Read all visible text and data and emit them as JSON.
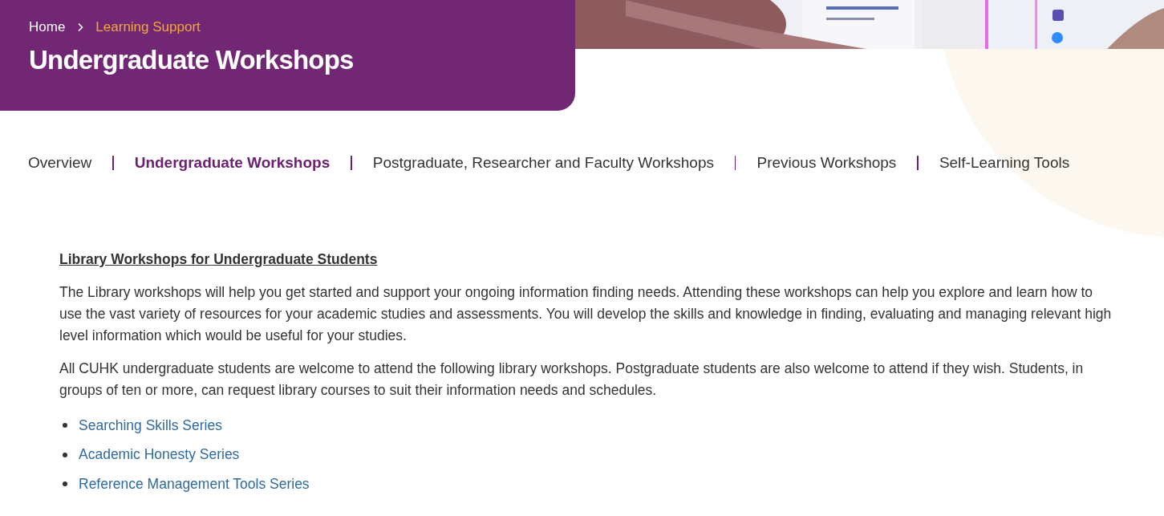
{
  "breadcrumb": [
    {
      "label": "Home",
      "current": false
    },
    {
      "label": "Learning Support",
      "current": true
    }
  ],
  "page_title": "Undergraduate Workshops",
  "banner": {
    "kind": "picture"
  },
  "tabs": [
    {
      "label": "Overview",
      "selected": false
    },
    {
      "label": "Undergraduate Workshops",
      "selected": true
    },
    {
      "label": "Postgraduate, Researcher and Faculty Workshops",
      "selected": false
    },
    {
      "label": "Previous Workshops",
      "selected": false
    },
    {
      "label": "Self-Learning Tools",
      "selected": false
    }
  ],
  "section_heading": "Library Workshops for Undergraduate Students",
  "paragraphs": [
    "The Library workshops will help you get started and support your ongoing information finding needs. Attending these workshops can help you explore and learn how to use the vast variety of resources for your academic studies and assessments. You will develop the skills and knowledge in finding, evaluating and managing relevant high level information which would be useful for your studies.",
    "All CUHK undergraduate students are welcome to attend the following library workshops. Postgraduate students are also welcome to attend if they wish. Students, in groups of ten or more, can request library courses to suit their information needs and schedules."
  ],
  "series_links": [
    "Searching Skills Series",
    "Academic Honesty Series",
    "Reference Management Tools Series"
  ]
}
